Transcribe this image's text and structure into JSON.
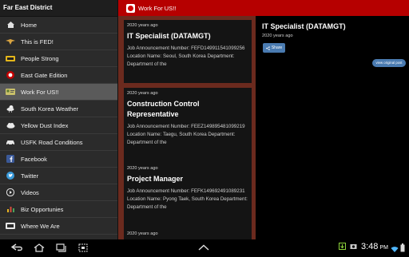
{
  "drawer": {
    "title": "Far East District",
    "items": [
      {
        "label": "Home",
        "icon": "home-icon"
      },
      {
        "label": "This is FED!",
        "icon": "eagle-icon"
      },
      {
        "label": "People Strong",
        "icon": "badge-icon"
      },
      {
        "label": "East Gate Edition",
        "icon": "red-circle-icon"
      },
      {
        "label": "Work For US!!",
        "icon": "id-card-icon",
        "active": true
      },
      {
        "label": "South Korea Weather",
        "icon": "weather-icon"
      },
      {
        "label": "Yellow Dust Index",
        "icon": "cloud-icon"
      },
      {
        "label": "USFK Road Conditions",
        "icon": "car-icon"
      },
      {
        "label": "Facebook",
        "icon": "facebook-icon"
      },
      {
        "label": "Twitter",
        "icon": "twitter-icon"
      },
      {
        "label": "Videos",
        "icon": "play-icon"
      },
      {
        "label": "Biz Opportunies",
        "icon": "chart-icon"
      },
      {
        "label": "Where We Are",
        "icon": "map-icon"
      }
    ]
  },
  "appbar": {
    "title": "Work For US!!"
  },
  "jobs": [
    {
      "date": "2020 years ago",
      "title": "IT Specialist (DATAMGT)",
      "body": "Job Announcement Number: FEFD149911541099256 Location Name: Seoul, South Korea Department: Department of the"
    },
    {
      "date": "2020 years ago",
      "title": "Construction Control Representative",
      "body": "Job Announcement Number: FEEZ149895481099219 Location Name: Taegu, South Korea Department: Department of the"
    },
    {
      "date": "2020 years ago",
      "title": "Project Manager",
      "body": "Job Announcement Number: FEFK149692491089231 Location Name: Pyong Taek, South Korea Department: Department of the"
    },
    {
      "date": "2020 years ago",
      "title": "",
      "body": ""
    }
  ],
  "detail": {
    "title": "IT Specialist (DATAMGT)",
    "date": "2020 years ago",
    "share_label": "Share",
    "view_label": "view original post"
  },
  "status": {
    "time": "3:48",
    "ampm": "PM"
  },
  "colors": {
    "appbar": "#b60000",
    "list_bg": "#6b2a1e",
    "share": "#4a7bb1",
    "drawer": "#2b2b2b"
  }
}
